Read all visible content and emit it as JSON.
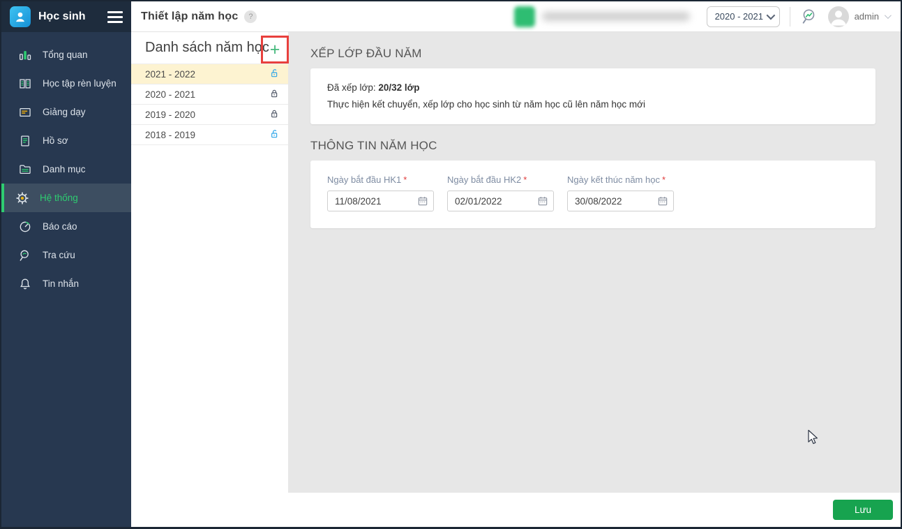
{
  "app": {
    "title": "Học sinh"
  },
  "sidebar": {
    "items": [
      {
        "label": "Tổng quan"
      },
      {
        "label": "Học tập rèn luyện"
      },
      {
        "label": "Giảng dạy"
      },
      {
        "label": "Hồ sơ"
      },
      {
        "label": "Danh mục"
      },
      {
        "label": "Hệ thống",
        "active": true
      },
      {
        "label": "Báo cáo"
      },
      {
        "label": "Tra cứu"
      },
      {
        "label": "Tin nhắn"
      }
    ]
  },
  "header": {
    "page_title": "Thiết lập năm học",
    "help_badge": "?",
    "year_selector_value": "2020 - 2021",
    "username": "admin"
  },
  "year_panel": {
    "title": "Danh sách năm học",
    "add_button_label": "+",
    "years": [
      {
        "label": "2021 - 2022",
        "selected": true,
        "lock": "unlocked"
      },
      {
        "label": "2020 - 2021",
        "selected": false,
        "lock": "locked"
      },
      {
        "label": "2019 - 2020",
        "selected": false,
        "lock": "locked"
      },
      {
        "label": "2018 - 2019",
        "selected": false,
        "lock": "unlocked"
      }
    ]
  },
  "main": {
    "class_assignment": {
      "title": "XẾP LỚP ĐẦU NĂM",
      "assigned_label": "Đã xếp lớp: ",
      "assigned_value": "20/32 lớp",
      "description": "Thực hiện kết chuyển, xếp lớp cho học sinh từ năm học cũ lên năm học mới"
    },
    "year_info": {
      "title": "THÔNG TIN NĂM HỌC",
      "fields": [
        {
          "label": "Ngày bắt đầu HK1",
          "required": "*",
          "value": "11/08/2021"
        },
        {
          "label": "Ngày bắt đầu HK2",
          "required": "*",
          "value": "02/01/2022"
        },
        {
          "label": "Ngày kết thúc năm học",
          "required": "*",
          "value": "30/08/2022"
        }
      ]
    }
  },
  "footer": {
    "save_label": "Lưu"
  },
  "colors": {
    "accent_green": "#2ecc71",
    "save_green": "#17a34f",
    "annotation_red": "#e8403d",
    "selected_year_bg": "#fdf3d1",
    "unlocked_blue": "#29a3e8",
    "sidebar_bg": "#273850",
    "main_bg": "#e7e7e7"
  }
}
